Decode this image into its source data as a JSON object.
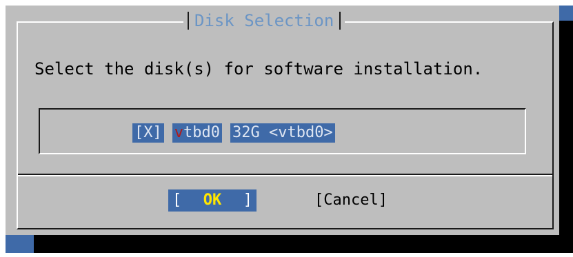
{
  "dialog": {
    "title": "Disk Selection",
    "prompt": "Select the disk(s) for software installation."
  },
  "disk_list": {
    "items": [
      {
        "checkbox": "[X]",
        "hotkey": "v",
        "name_rest": "tbd0",
        "description": "32G <vtbd0>",
        "checked": true
      }
    ]
  },
  "buttons": {
    "ok_left_bracket": "[",
    "ok_label": "OK",
    "ok_right_bracket": "]",
    "cancel_label": "[Cancel]"
  },
  "colors": {
    "background": "#3f6aa8",
    "dialog": "#bebebe",
    "title_text": "#6b95c5",
    "highlight": "#3f6aa8",
    "hotkey": "#b01a1a",
    "ok_label": "#ffe600"
  }
}
